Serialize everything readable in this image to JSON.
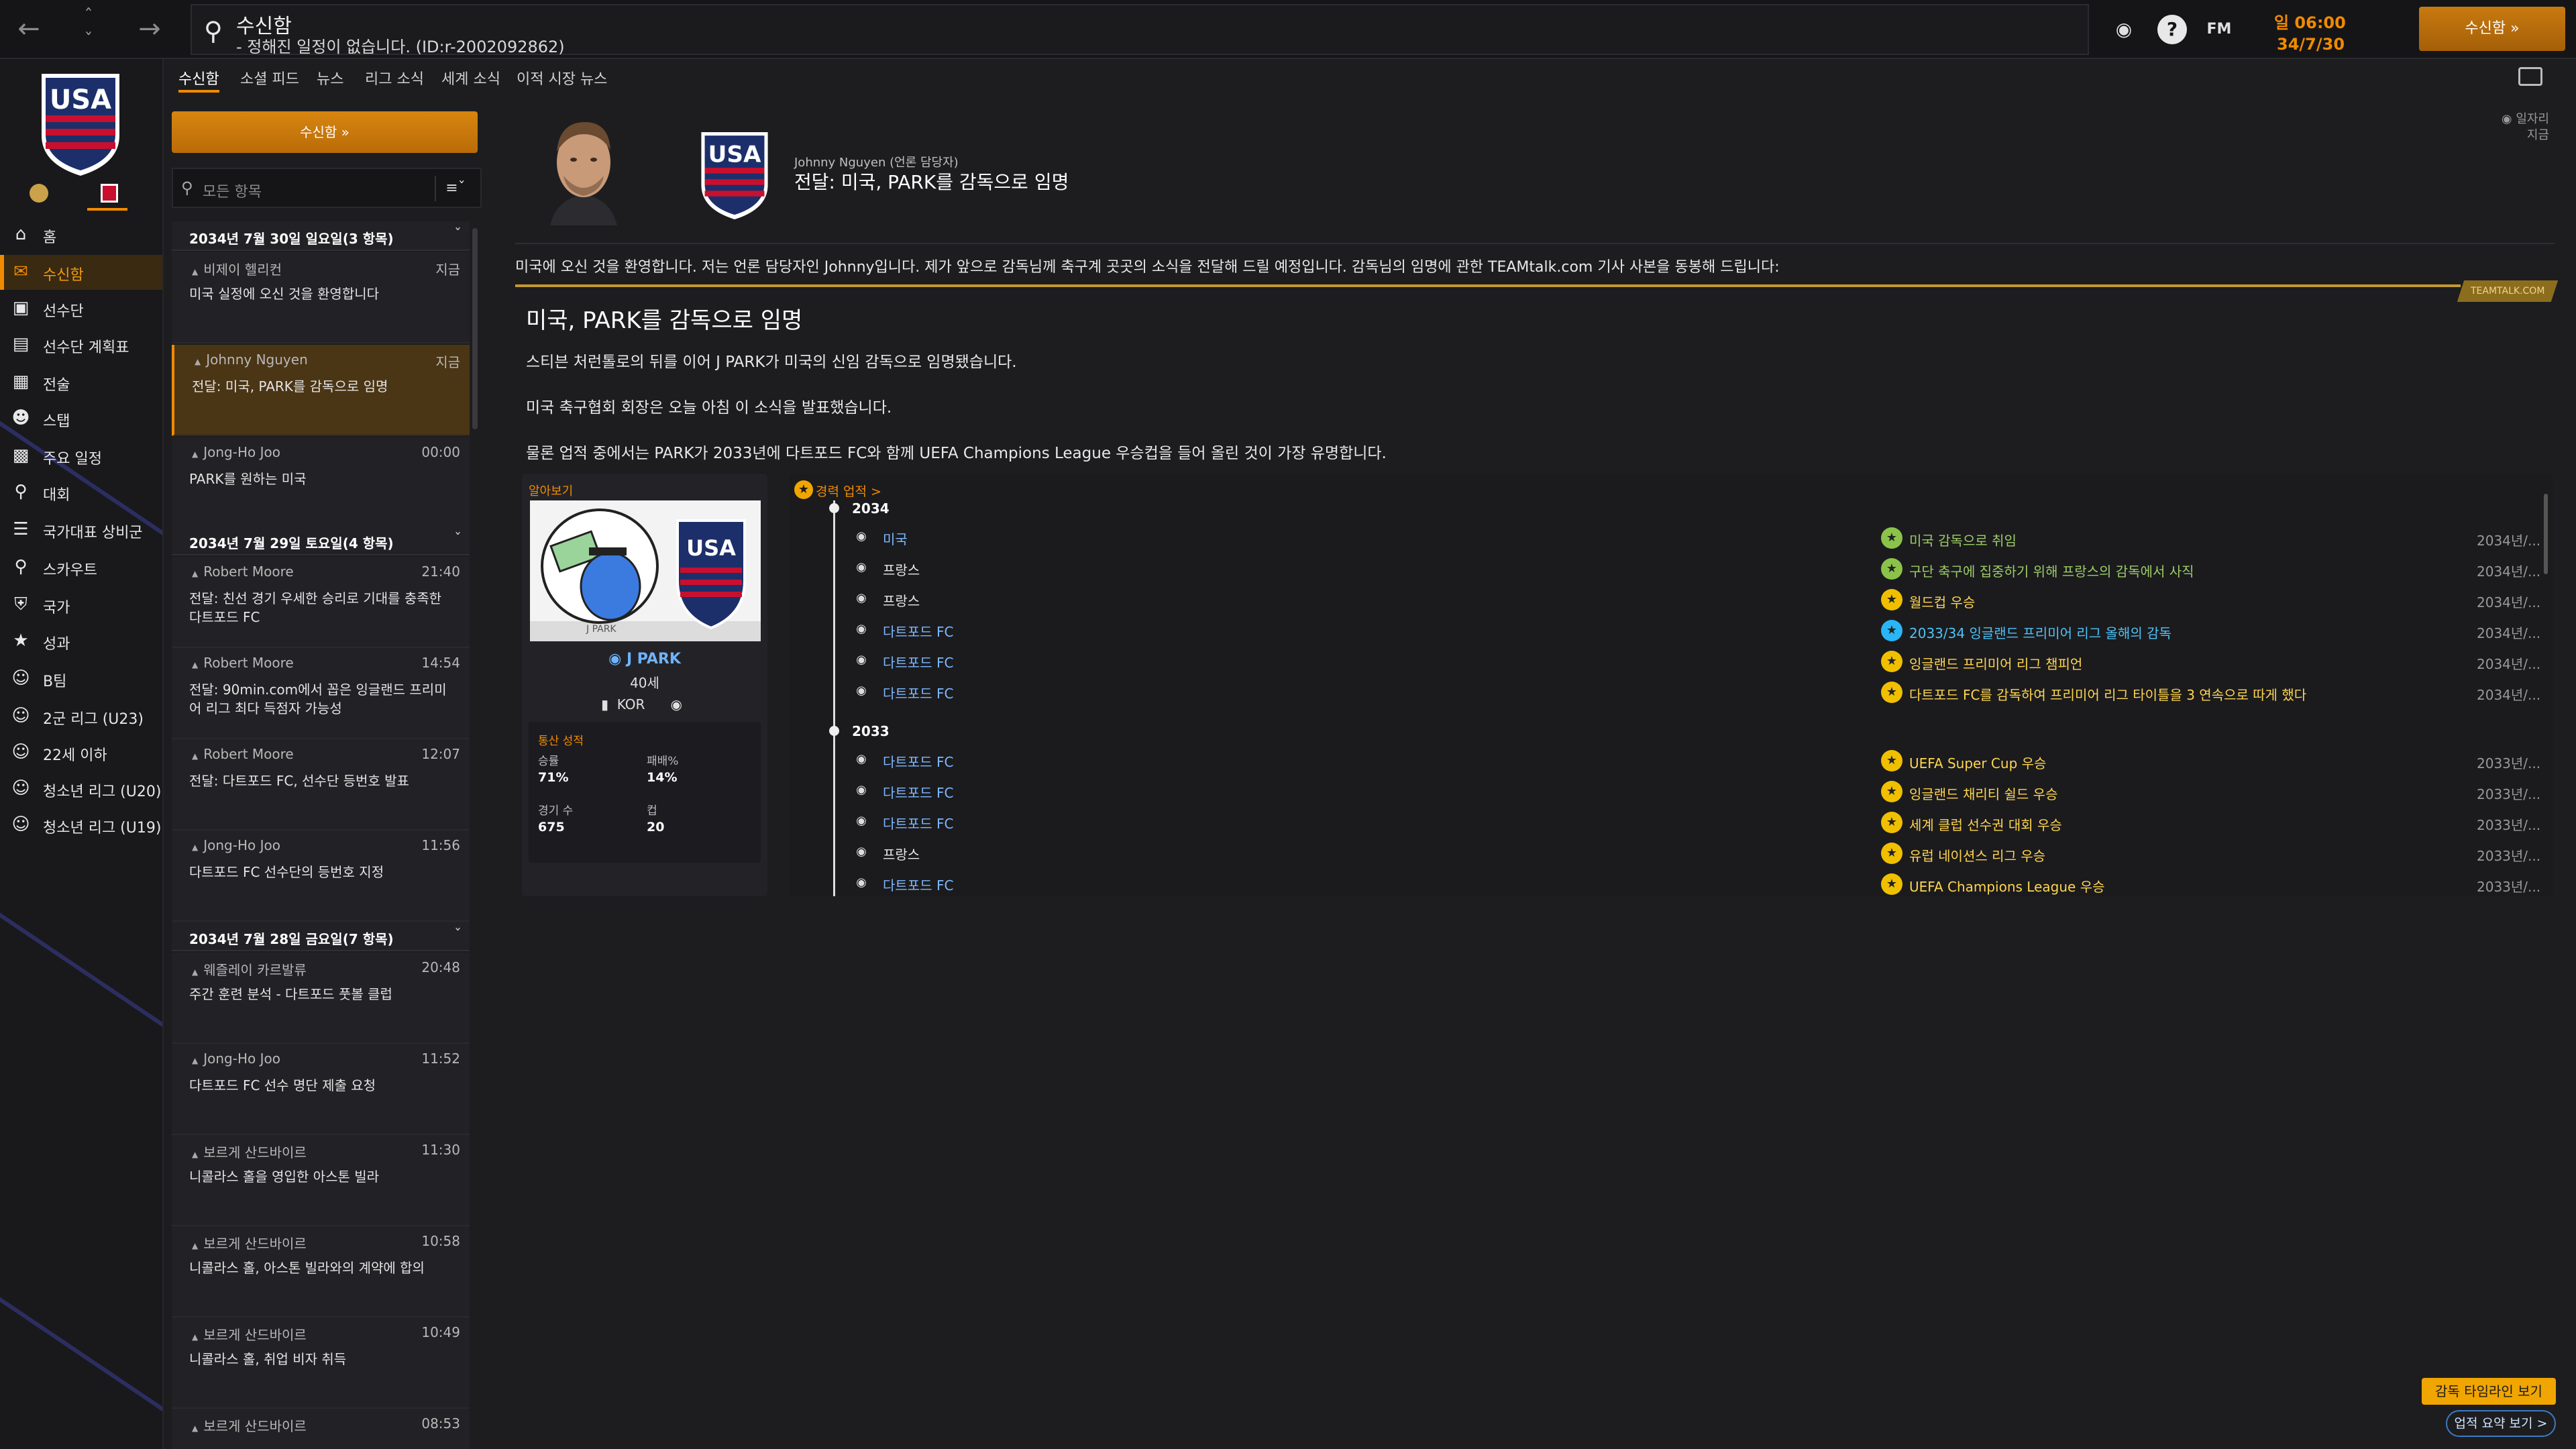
{
  "topbar": {
    "back_icon": "arrow-left-icon",
    "forward_icon": "arrow-right-icon",
    "search_title": "수신함",
    "search_subtitle": "- 정해진 일정이 없습니다. (ID:r-2002092862)",
    "fm_label": "FM",
    "time": "일 06:00",
    "date": "34/7/30",
    "continue_label": "수신함"
  },
  "leftnav": {
    "items": [
      {
        "label": "홈",
        "icon": "home-icon"
      },
      {
        "label": "수신함",
        "icon": "inbox-icon",
        "active": true
      },
      {
        "label": "선수단",
        "icon": "shirt-icon"
      },
      {
        "label": "선수단 계획표",
        "icon": "plan-icon"
      },
      {
        "label": "전술",
        "icon": "tactics-icon"
      },
      {
        "label": "스탭",
        "icon": "staff-icon"
      },
      {
        "label": "주요 일정",
        "icon": "calendar-icon"
      },
      {
        "label": "대회",
        "icon": "trophy-icon"
      },
      {
        "label": "국가대표 상비군",
        "icon": "list-icon"
      },
      {
        "label": "스카우트",
        "icon": "scout-icon"
      },
      {
        "label": "국가",
        "icon": "shield-icon"
      },
      {
        "label": "성과",
        "icon": "achievement-icon"
      },
      {
        "label": "B팀",
        "icon": "team-icon"
      },
      {
        "label": "2군 리그 (U23)",
        "icon": "team-icon"
      },
      {
        "label": "22세 이하",
        "icon": "team-icon"
      },
      {
        "label": "청소년 리그 (U20)",
        "icon": "team-icon"
      },
      {
        "label": "청소년 리그 (U19)",
        "icon": "team-icon"
      }
    ]
  },
  "subtabs": [
    "수신함",
    "소셜 피드",
    "뉴스",
    "리그 소식",
    "세계 소식",
    "이적 시장 뉴스"
  ],
  "inbox": {
    "continue_label": "수신함",
    "filter_placeholder": "모든 항목",
    "days": [
      {
        "header": "2034년 7월 30일 일요일(3 항목)"
      },
      {
        "header": "2034년 7월 29일 토요일(4 항목)"
      },
      {
        "header": "2034년 7월 28일 금요일(7 항목)"
      }
    ],
    "messages": [
      {
        "sender": "비제이 헬리컨",
        "time": "지금",
        "body": "미국 실정에 오신 것을 환영합니다"
      },
      {
        "sender": "Johnny Nguyen",
        "time": "지금",
        "body": "전달: 미국, PARK를 감독으로 임명"
      },
      {
        "sender": "Jong-Ho Joo",
        "time": "00:00",
        "body": "PARK를 원하는 미국"
      },
      {
        "sender": "Robert Moore",
        "time": "21:40",
        "body": "전달: 친선 경기 우세한 승리로 기대를 충족한 다트포드 FC"
      },
      {
        "sender": "Robert Moore",
        "time": "14:54",
        "body": "전달: 90min.com에서 꼽은 잉글랜드 프리미어 리그 최다 득점자 가능성"
      },
      {
        "sender": "Robert Moore",
        "time": "12:07",
        "body": "전달: 다트포드 FC, 선수단 등번호 발표"
      },
      {
        "sender": "Jong-Ho Joo",
        "time": "11:56",
        "body": "다트포드 FC 선수단의 등번호 지정"
      },
      {
        "sender": "웨즐레이 카르발류",
        "time": "20:48",
        "body": "주간 훈련 분석 - 다트포드 풋볼 클럽"
      },
      {
        "sender": "Jong-Ho Joo",
        "time": "11:52",
        "body": "다트포드 FC 선수 명단 제출 요청"
      },
      {
        "sender": "보르게 산드바이르",
        "time": "11:30",
        "body": "니콜라스 홀을 영입한 아스톤 빌라"
      },
      {
        "sender": "보르게 산드바이르",
        "time": "10:58",
        "body": "니콜라스 홀, 아스톤 빌라와의 계약에 합의"
      },
      {
        "sender": "보르게 산드바이르",
        "time": "10:49",
        "body": "니콜라스 홀, 취업 비자 취득"
      },
      {
        "sender": "보르게 산드바이르",
        "time": "08:53",
        "body": ""
      }
    ]
  },
  "message": {
    "sender": "Johnny Nguyen (언론 담당자)",
    "subject": "전달: 미국, PARK를 감독으로 임명",
    "top_right_1": "일자리",
    "top_right_2": "지금",
    "intro": "미국에 오신 것을 환영합니다. 저는 언론 담당자인 Johnny입니다. 제가 앞으로 감독님께 축구계 곳곳의 소식을 전달해 드릴 예정입니다. 감독님의 임명에 관한 TEAMtalk.com 기사 사본을 동봉해 드립니다:",
    "source": "TEAMTALK.COM",
    "article_title": "미국, PARK를 감독으로 임명",
    "paragraphs": [
      "스티븐 처런톨로의 뒤를 이어 J PARK가 미국의 신임 감독으로 임명됐습니다.",
      "미국 축구협회 회장은 오늘 아침 이 소식을 발표했습니다.",
      "물론 업적 중에서는 PARK가 2033년에 다트포드 FC와 함께 UEFA Champions League 우승컵을 들어 올린 것이 가장 유명합니다."
    ]
  },
  "card": {
    "label": "알아보기",
    "name": "J PARK",
    "age": "40세",
    "nation": "KOR",
    "stats_label": "통산 성적",
    "win_label": "승률",
    "win_value": "71%",
    "loss_label": "패배%",
    "loss_value": "14%",
    "games_label": "경기 수",
    "games_value": "675",
    "cups_label": "컵",
    "cups_value": "20",
    "img_caption": "J PARK"
  },
  "timeline": {
    "header": "경력 업적 >",
    "years": [
      "2034",
      "2033"
    ],
    "rows_2034": [
      {
        "club": "미국",
        "event": "미국 감독으로 취임",
        "date": "2034년/...",
        "club_color": "#7db8ff",
        "event_color": "#9ccc65",
        "icon_color": "#8bc34a"
      },
      {
        "club": "프랑스",
        "event": "구단 축구에 집중하기 위해 프랑스의 감독에서 사직",
        "date": "2034년/...",
        "club_color": "#e8e8e8",
        "event_color": "#9ccc65",
        "icon_color": "#8bc34a"
      },
      {
        "club": "프랑스",
        "event": "월드컵 우승",
        "date": "2034년/...",
        "club_color": "#e8e8e8",
        "event_color": "#ffd54f",
        "icon_color": "#f0c000"
      },
      {
        "club": "다트포드 FC",
        "event": "2033/34 잉글랜드 프리미어 리그 올해의 감독",
        "date": "2034년/...",
        "club_color": "#7db8ff",
        "event_color": "#4fc3f7",
        "icon_color": "#29b6f6"
      },
      {
        "club": "다트포드 FC",
        "event": "잉글랜드 프리미어 리그 챔피언",
        "date": "2034년/...",
        "club_color": "#7db8ff",
        "event_color": "#ffd54f",
        "icon_color": "#f0c000"
      },
      {
        "club": "다트포드 FC",
        "event": "다트포드 FC를 감독하여 프리미어 리그 타이틀을 3 연속으로 따게 했다",
        "date": "2034년/...",
        "club_color": "#7db8ff",
        "event_color": "#ffd54f",
        "icon_color": "#f0c000"
      }
    ],
    "rows_2033": [
      {
        "club": "다트포드 FC",
        "event": "UEFA Super Cup 우승",
        "date": "2033년/...",
        "club_color": "#7db8ff",
        "event_color": "#ffd54f",
        "icon_color": "#f0c000"
      },
      {
        "club": "다트포드 FC",
        "event": "잉글랜드 채리티 쉴드 우승",
        "date": "2033년/...",
        "club_color": "#7db8ff",
        "event_color": "#ffd54f",
        "icon_color": "#f0c000"
      },
      {
        "club": "다트포드 FC",
        "event": "세계 클럽 선수권 대회 우승",
        "date": "2033년/...",
        "club_color": "#7db8ff",
        "event_color": "#ffd54f",
        "icon_color": "#f0c000"
      },
      {
        "club": "프랑스",
        "event": "유럽 네이션스 리그 우승",
        "date": "2033년/...",
        "club_color": "#e8e8e8",
        "event_color": "#ffd54f",
        "icon_color": "#f0c000"
      },
      {
        "club": "다트포드 FC",
        "event": "UEFA Champions League 우승",
        "date": "2033년/...",
        "club_color": "#7db8ff",
        "event_color": "#ffd54f",
        "icon_color": "#f0c000"
      }
    ]
  },
  "bottom": {
    "timeline_btn": "감독 타임라인 보기",
    "summary_btn": "업적 요약 보기 >"
  }
}
